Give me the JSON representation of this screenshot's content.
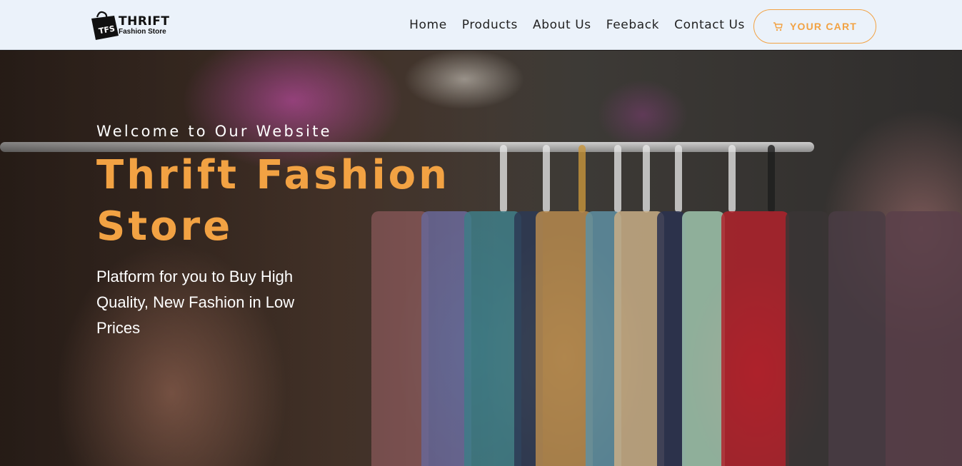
{
  "brand": {
    "logo_mark": "TFS",
    "name_line1": "THRIFT",
    "name_line2": "Fashion Store"
  },
  "nav": {
    "links": [
      {
        "label": "Home"
      },
      {
        "label": "Products"
      },
      {
        "label": "About Us"
      },
      {
        "label": "Feeback"
      },
      {
        "label": "Contact Us"
      }
    ],
    "cart": {
      "label": "YOUR CART",
      "icon": "cart-icon"
    }
  },
  "hero": {
    "subtitle": "Welcome to Our Website",
    "title": "Thrift Fashion Store",
    "description": "Platform for you to Buy High Quality, New Fashion in Low Prices"
  },
  "colors": {
    "accent": "#f2a243",
    "navbar_bg": "#ebf2fa",
    "nav_text": "#222222",
    "hero_text": "#ffffff"
  }
}
